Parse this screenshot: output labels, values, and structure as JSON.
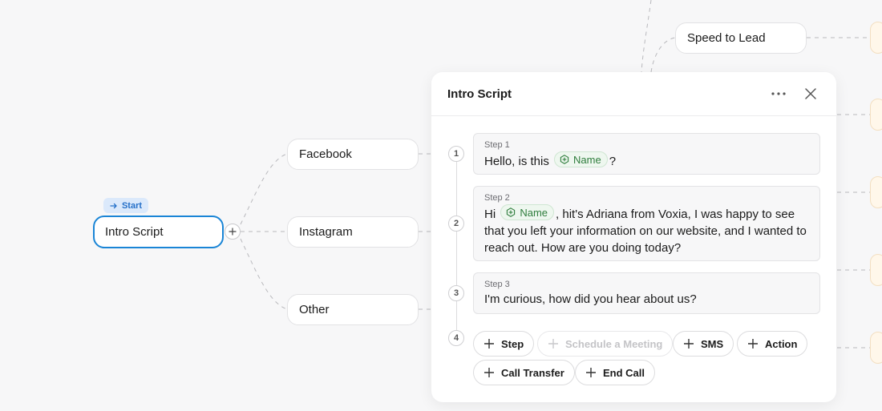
{
  "canvas": {
    "start_badge": "Start",
    "nodes": {
      "intro_script": "Intro Script",
      "facebook": "Facebook",
      "instagram": "Instagram",
      "other": "Other",
      "speed_to_lead": "Speed to Lead"
    }
  },
  "panel": {
    "title": "Intro Script",
    "steps": [
      {
        "number": "1",
        "label": "Step 1",
        "text_before": "Hello, is this",
        "chip": "Name",
        "text_after": "?"
      },
      {
        "number": "2",
        "label": "Step 2",
        "text_before": "Hi",
        "chip": "Name",
        "text_after": ", hit's Adriana from Voxia, I was happy to see that you left your information on our website, and I wanted to reach out. How are you doing today?"
      },
      {
        "number": "3",
        "label": "Step 3",
        "text": "I'm curious, how did you hear about us?"
      }
    ],
    "next_step_number": "4",
    "add_buttons": [
      {
        "label": "Step",
        "enabled": true
      },
      {
        "label": "Schedule a Meeting",
        "enabled": false
      },
      {
        "label": "SMS",
        "enabled": true
      },
      {
        "label": "Action",
        "enabled": true
      },
      {
        "label": "Call Transfer",
        "enabled": true
      },
      {
        "label": "End Call",
        "enabled": true
      }
    ]
  },
  "colors": {
    "selected_border": "#1a85d6",
    "start_badge_bg": "#dbe9fb",
    "chip_green": "#2e7d3c"
  }
}
